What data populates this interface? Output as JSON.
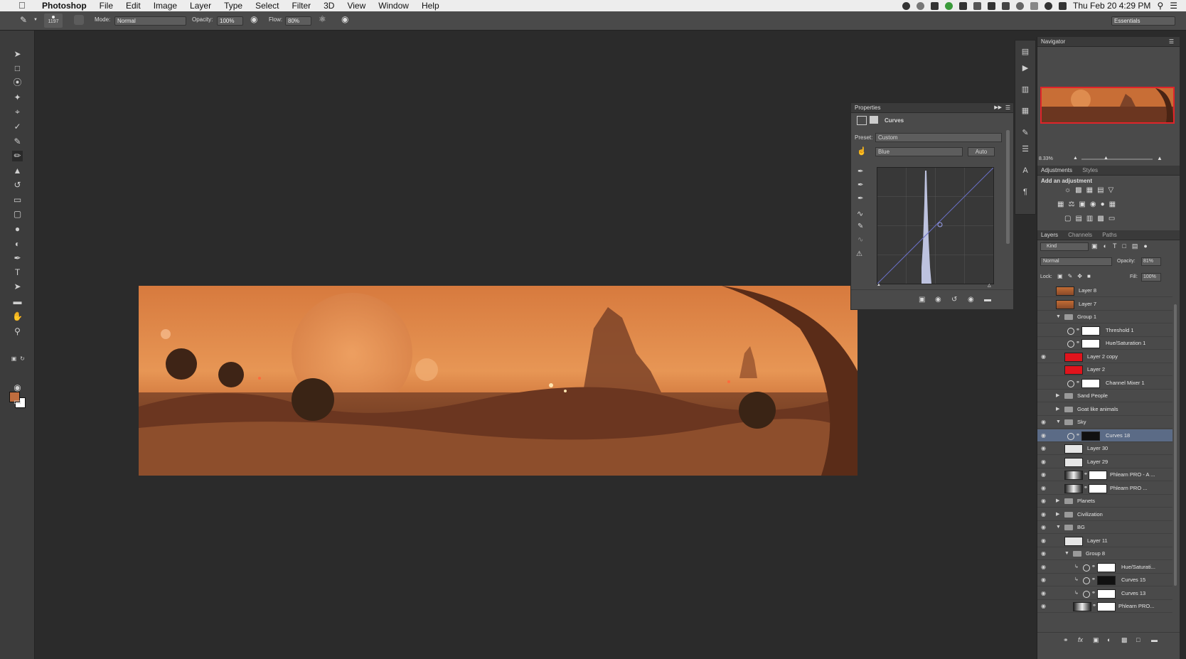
{
  "menubar": {
    "app_name": "Photoshop",
    "items": [
      "File",
      "Edit",
      "Image",
      "Layer",
      "Type",
      "Select",
      "Filter",
      "3D",
      "View",
      "Window",
      "Help"
    ],
    "clock": "Thu Feb 20  4:29 PM"
  },
  "options": {
    "brush_size": "1197",
    "mode_label": "Mode:",
    "mode_value": "Normal",
    "opacity_label": "Opacity:",
    "opacity_value": "100%",
    "flow_label": "Flow:",
    "flow_value": "80%",
    "workspace": "Essentials"
  },
  "tools": [
    "move-tool-icon",
    "marquee-tool-icon",
    "lasso-tool-icon",
    "quick-select-tool-icon",
    "crop-tool-icon",
    "eyedropper-tool-icon",
    "healing-brush-tool-icon",
    "brush-tool-icon",
    "clone-stamp-tool-icon",
    "history-brush-tool-icon",
    "eraser-tool-icon",
    "gradient-tool-icon",
    "blur-tool-icon",
    "dodge-tool-icon",
    "pen-tool-icon",
    "type-tool-icon",
    "path-select-tool-icon",
    "rectangle-tool-icon",
    "hand-tool-icon",
    "zoom-tool-icon"
  ],
  "colors": {
    "foreground": "#c06d3e",
    "background": "#ffffff",
    "selection": "#5b6b86",
    "curve": "#6b70c8",
    "navigator_frame": "#e0242a"
  },
  "properties": {
    "tab": "Properties",
    "adjustment": "Curves",
    "preset_label": "Preset:",
    "preset_value": "Custom",
    "channel_value": "Blue",
    "auto_label": "Auto"
  },
  "navigator": {
    "tab": "Navigator",
    "zoom": "8.33%"
  },
  "adjustments": {
    "tabs": [
      "Adjustments",
      "Styles"
    ],
    "heading": "Add an adjustment"
  },
  "layers_panel": {
    "tabs": [
      "Layers",
      "Channels",
      "Paths"
    ],
    "kind_label": "Kind",
    "blend_mode": "Normal",
    "opacity_label": "Opacity:",
    "opacity_value": "81%",
    "lock_label": "Lock:",
    "fill_label": "Fill:",
    "fill_value": "100%",
    "layers": [
      {
        "name": "Layer 8",
        "visible": false,
        "kind": "pixel",
        "indent": 0
      },
      {
        "name": "Layer 7",
        "visible": false,
        "kind": "pixel",
        "indent": 0
      },
      {
        "name": "Group 1",
        "visible": false,
        "kind": "group",
        "indent": 0
      },
      {
        "name": "Threshold 1",
        "visible": false,
        "kind": "adjust",
        "indent": 1
      },
      {
        "name": "Hue/Saturation 1",
        "visible": false,
        "kind": "adjust",
        "indent": 1
      },
      {
        "name": "Layer 2 copy",
        "visible": true,
        "kind": "red",
        "indent": 1
      },
      {
        "name": "Layer 2",
        "visible": false,
        "kind": "red",
        "indent": 1
      },
      {
        "name": "Channel Mixer 1",
        "visible": false,
        "kind": "adjust",
        "indent": 1
      },
      {
        "name": "Sand People",
        "visible": false,
        "kind": "group-closed",
        "indent": 0
      },
      {
        "name": "Goat like animals",
        "visible": false,
        "kind": "group-closed",
        "indent": 0
      },
      {
        "name": "Sky",
        "visible": true,
        "kind": "group",
        "indent": 0
      },
      {
        "name": "Curves 18",
        "visible": true,
        "kind": "adjust-dark",
        "indent": 1,
        "selected": true
      },
      {
        "name": "Layer 30",
        "visible": true,
        "kind": "white",
        "indent": 1
      },
      {
        "name": "Layer 29",
        "visible": true,
        "kind": "white",
        "indent": 1
      },
      {
        "name": "Phlearn PRO - A ...",
        "visible": true,
        "kind": "masked",
        "indent": 1
      },
      {
        "name": "Phlearn PRO ...",
        "visible": true,
        "kind": "masked",
        "indent": 1
      },
      {
        "name": "Planets",
        "visible": true,
        "kind": "group-closed",
        "indent": 0
      },
      {
        "name": "Civilization",
        "visible": true,
        "kind": "group-closed",
        "indent": 0
      },
      {
        "name": "BG",
        "visible": true,
        "kind": "group",
        "indent": 0
      },
      {
        "name": "Layer 11",
        "visible": true,
        "kind": "white",
        "indent": 1
      },
      {
        "name": "Group 8",
        "visible": true,
        "kind": "group",
        "indent": 1
      },
      {
        "name": "Hue/Saturati...",
        "visible": true,
        "kind": "adjust-clip",
        "indent": 2
      },
      {
        "name": "Curves 15",
        "visible": true,
        "kind": "adjust-clip-dark",
        "indent": 2
      },
      {
        "name": "Curves 13",
        "visible": true,
        "kind": "adjust-clip",
        "indent": 2
      },
      {
        "name": "Phlearn PRO...",
        "visible": true,
        "kind": "masked",
        "indent": 2
      }
    ]
  }
}
